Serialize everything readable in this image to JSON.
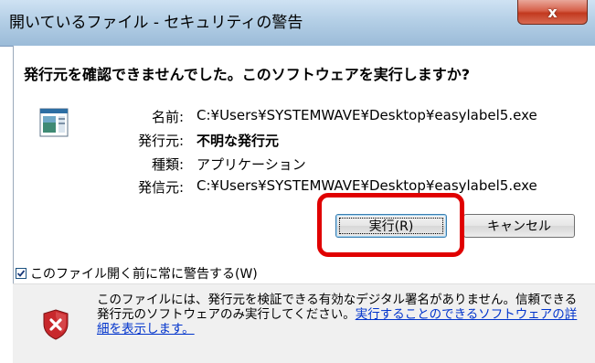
{
  "window": {
    "title": "開いているファイル - セキュリティの警告",
    "close_label": "x"
  },
  "dialog": {
    "question": "発行元を確認できませんでした。このソフトウェアを実行しますか?",
    "fields": [
      {
        "label": "名前:",
        "value": "C:¥Users¥SYSTEMWAVE¥Desktop¥easylabel5.exe"
      },
      {
        "label": "発行元:",
        "value": "不明な発行元"
      },
      {
        "label": "種類:",
        "value": "アプリケーション"
      },
      {
        "label": "発信元:",
        "value": "C:¥Users¥SYSTEMWAVE¥Desktop¥easylabel5.exe"
      }
    ],
    "run_button": "実行(R)",
    "cancel_button": "キャンセル",
    "checkbox_label": "このファイル開く前に常に警告する(W)",
    "checkbox_checked": true
  },
  "footer": {
    "text": "このファイルには、発行元を検証できる有効なデジタル署名がありません。信頼できる発行元のソフトウェアのみ実行してください。",
    "link": "実行することのできるソフトウェアの詳細を表示します。"
  },
  "colors": {
    "highlight": "#e00000",
    "link": "#0033cc"
  }
}
